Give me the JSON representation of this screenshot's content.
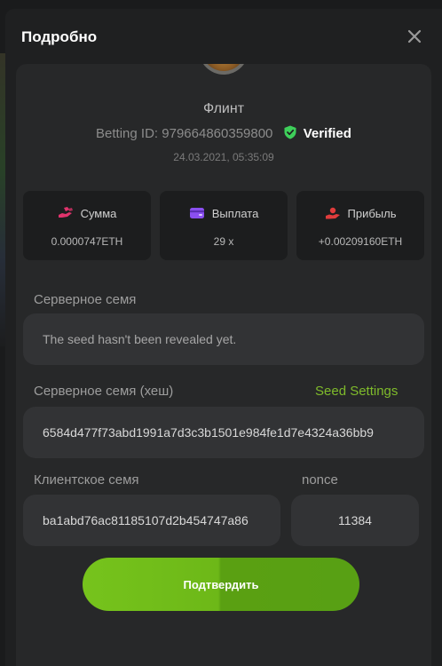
{
  "modal": {
    "title": "Подробно"
  },
  "player": {
    "name": "Флинт",
    "betting_id_label": "Betting ID:",
    "betting_id": "979664860359800",
    "verified_label": "Verified",
    "timestamp": "24.03.2021, 05:35:09"
  },
  "stats": [
    {
      "label": "Сумма",
      "value": "0.0000747ETH",
      "icon": "hand-coins-icon",
      "icon_color": "#e0336c"
    },
    {
      "label": "Выплата",
      "value": "29 x",
      "icon": "wallet-icon",
      "icon_color": "#8a4ff0"
    },
    {
      "label": "Прибыль",
      "value": "+0.00209160ETH",
      "icon": "profit-hand-icon",
      "icon_color": "#e03c3c"
    }
  ],
  "server_seed": {
    "label": "Серверное семя",
    "value": "The seed hasn't been revealed yet."
  },
  "server_seed_hash": {
    "label": "Серверное семя (хеш)",
    "settings_link": "Seed Settings",
    "value": "6584d477f73abd1991a7d3c3b1501e984fe1d7e4324a36bb9"
  },
  "client_seed": {
    "label": "Клиентское семя",
    "value": "ba1abd76ac81185107d2b454747a86"
  },
  "nonce": {
    "label": "nonce",
    "value": "11384"
  },
  "confirm_label": "Подтвердить",
  "colors": {
    "accent_green": "#7fbb2b",
    "verified_green": "#3ecf5a",
    "panel_bg": "#272829",
    "field_bg": "#323335"
  }
}
